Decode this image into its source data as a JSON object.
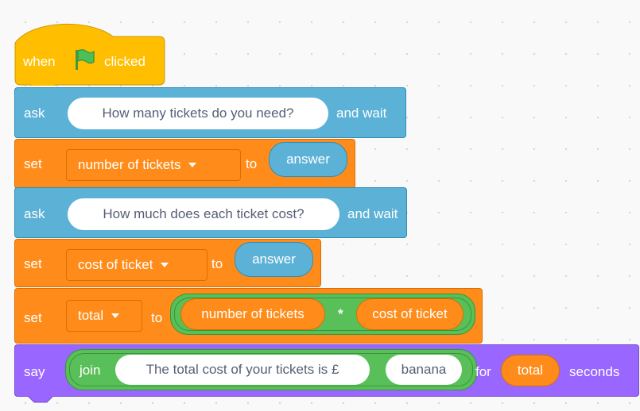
{
  "script": {
    "hat": {
      "when": "when",
      "clicked": "clicked"
    },
    "ask1": {
      "keyword": "ask",
      "question": "How many tickets do you need?",
      "and_wait": "and wait"
    },
    "set1": {
      "keyword": "set",
      "variable": "number of tickets",
      "to": "to",
      "value": "answer"
    },
    "ask2": {
      "keyword": "ask",
      "question": "How much does each ticket cost?",
      "and_wait": "and wait"
    },
    "set2": {
      "keyword": "set",
      "variable": "cost of ticket",
      "to": "to",
      "value": "answer"
    },
    "set3": {
      "keyword": "set",
      "variable": "total",
      "to": "to",
      "left": "number of tickets",
      "operator": "*",
      "right": "cost of ticket"
    },
    "say": {
      "keyword": "say",
      "join": "join",
      "text1": "The total cost of your tickets is £",
      "text2": "banana",
      "for": "for",
      "duration": "total",
      "seconds": "seconds"
    }
  },
  "colors": {
    "events": "#ffbf00",
    "sensing": "#5cb1d6",
    "variables": "#ff8c1a",
    "operators": "#59c059",
    "looks": "#9966ff"
  },
  "icons": {
    "green_flag": "green-flag-icon",
    "dropdown": "dropdown-caret-icon"
  }
}
